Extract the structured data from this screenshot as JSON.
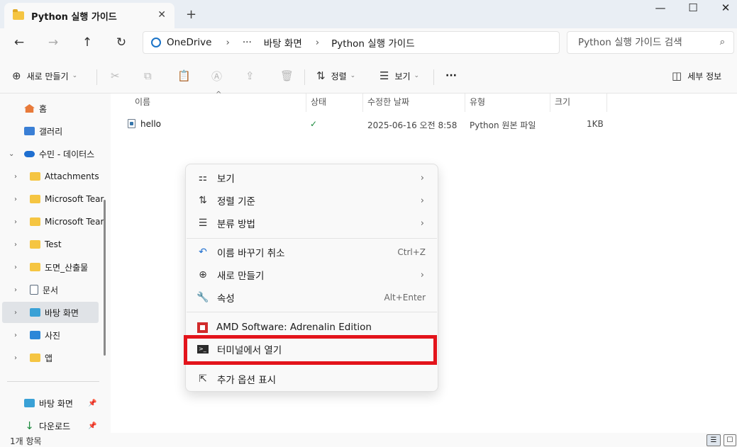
{
  "tab": {
    "title": "Python 실행 가이드",
    "close": "✕",
    "new_tab": "+"
  },
  "window_controls": {
    "minimize": "—",
    "maximize": "☐",
    "close": "✕"
  },
  "nav_buttons": {
    "back": "←",
    "forward": "→",
    "up": "↑",
    "refresh": "↻"
  },
  "breadcrumb": [
    "OneDrive",
    "›",
    "···",
    "바탕 화면",
    "›",
    "Python 실행 가이드"
  ],
  "search": {
    "placeholder": "Python 실행 가이드 검색",
    "icon": "⌕"
  },
  "toolbar": {
    "new_label": "새로 만들기",
    "new_icon": "⊕",
    "cut_icon": "✂",
    "copy_icon": "⧉",
    "paste_icon": "📋",
    "rename_icon": "Ⓐ",
    "share_icon": "⇪",
    "delete_icon": "🗑",
    "sort_label": "정렬",
    "sort_icon": "⇅",
    "view_label": "보기",
    "view_icon": "☰",
    "more_icon": "···",
    "details_label": "세부 정보",
    "details_icon": "◫",
    "chevron": "⌄"
  },
  "sidebar": {
    "items": [
      {
        "label": "홈",
        "icon": "home"
      },
      {
        "label": "갤러리",
        "icon": "gallery"
      },
      {
        "label": "수민 - 데이터스",
        "icon": "cloud",
        "expander": "⌄"
      },
      {
        "label": "Attachments",
        "icon": "folder",
        "expander": "›"
      },
      {
        "label": "Microsoft Tear",
        "icon": "folder",
        "expander": "›"
      },
      {
        "label": "Microsoft Tear",
        "icon": "folder",
        "expander": "›"
      },
      {
        "label": "Test",
        "icon": "folder",
        "expander": "›"
      },
      {
        "label": "도면_산출물",
        "icon": "folder",
        "expander": "›"
      },
      {
        "label": "문서",
        "icon": "doc",
        "expander": "›"
      },
      {
        "label": "바탕 화면",
        "icon": "desk",
        "expander": "›",
        "selected": true
      },
      {
        "label": "사진",
        "icon": "photo",
        "expander": "›"
      },
      {
        "label": "앱",
        "icon": "folder",
        "expander": "›"
      }
    ],
    "pinned": [
      {
        "label": "바탕 화면",
        "icon": "desk",
        "pin": "📌"
      },
      {
        "label": "다운로드",
        "icon": "down",
        "pin": "📌"
      }
    ]
  },
  "columns": [
    "이름",
    "상태",
    "수정한 날짜",
    "유형",
    "크기"
  ],
  "sort_indicator": "^",
  "files": [
    {
      "name": "hello",
      "status": "✓",
      "modified": "2025-06-16 오전 8:58",
      "type": "Python 원본 파일",
      "size": "1KB"
    }
  ],
  "context_menu": {
    "view": {
      "label": "보기",
      "icon": "⚏",
      "arrow": "›"
    },
    "sort_by": {
      "label": "정렬 기준",
      "icon": "⇅",
      "arrow": "›"
    },
    "group_by": {
      "label": "분류 방법",
      "icon": "☰",
      "arrow": "›"
    },
    "undo_rename": {
      "label": "이름 바꾸기 취소",
      "icon": "↶",
      "shortcut": "Ctrl+Z"
    },
    "new": {
      "label": "새로 만들기",
      "icon": "⊕",
      "arrow": "›"
    },
    "properties": {
      "label": "속성",
      "icon": "🔧",
      "shortcut": "Alt+Enter"
    },
    "amd": {
      "label": "AMD Software: Adrenalin Edition"
    },
    "terminal": {
      "label": "터미널에서 열기",
      "icon_text": ">_"
    },
    "more_options": {
      "label": "추가 옵션 표시",
      "icon": "⇱"
    }
  },
  "highlight_color": "#e3141b",
  "statusbar": {
    "count": "1개 항목",
    "details_view": "☰",
    "tiles_view": "☐"
  }
}
